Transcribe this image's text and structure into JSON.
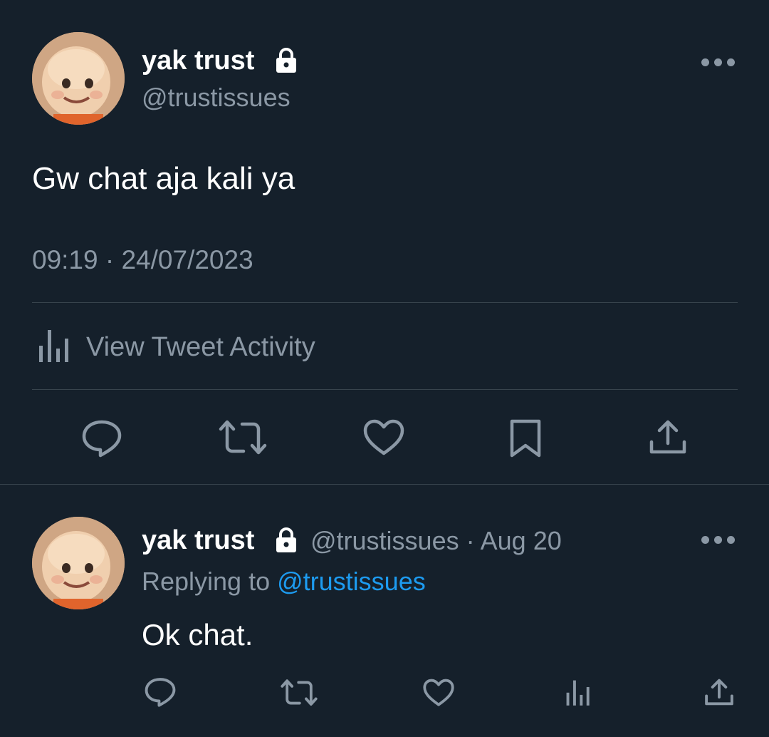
{
  "main_tweet": {
    "author": {
      "display_name": "yak trust",
      "handle": "@trustissues",
      "protected": true,
      "avatar_icon": "cartoon-boy-avatar"
    },
    "text": "Gw chat aja kali ya",
    "time": "09:19",
    "separator": "·",
    "date": "24/07/2023",
    "activity_label": "View Tweet Activity",
    "actions": [
      "reply-icon",
      "retweet-icon",
      "like-icon",
      "bookmark-icon",
      "share-icon"
    ]
  },
  "reply_tweet": {
    "author": {
      "display_name": "yak trust",
      "handle": "@trustissues",
      "protected": true,
      "avatar_icon": "cartoon-boy-avatar"
    },
    "separator": "·",
    "date": "Aug 20",
    "replying_prefix": "Replying to",
    "replying_to": "@trustissues",
    "text": "Ok chat.",
    "actions": [
      "reply-icon",
      "retweet-icon",
      "analytics-icon",
      "share-icon"
    ]
  },
  "colors": {
    "background": "#15202b",
    "text": "#ffffff",
    "muted": "#8b98a5",
    "accent": "#1d9bf0",
    "divider": "#38444d"
  }
}
